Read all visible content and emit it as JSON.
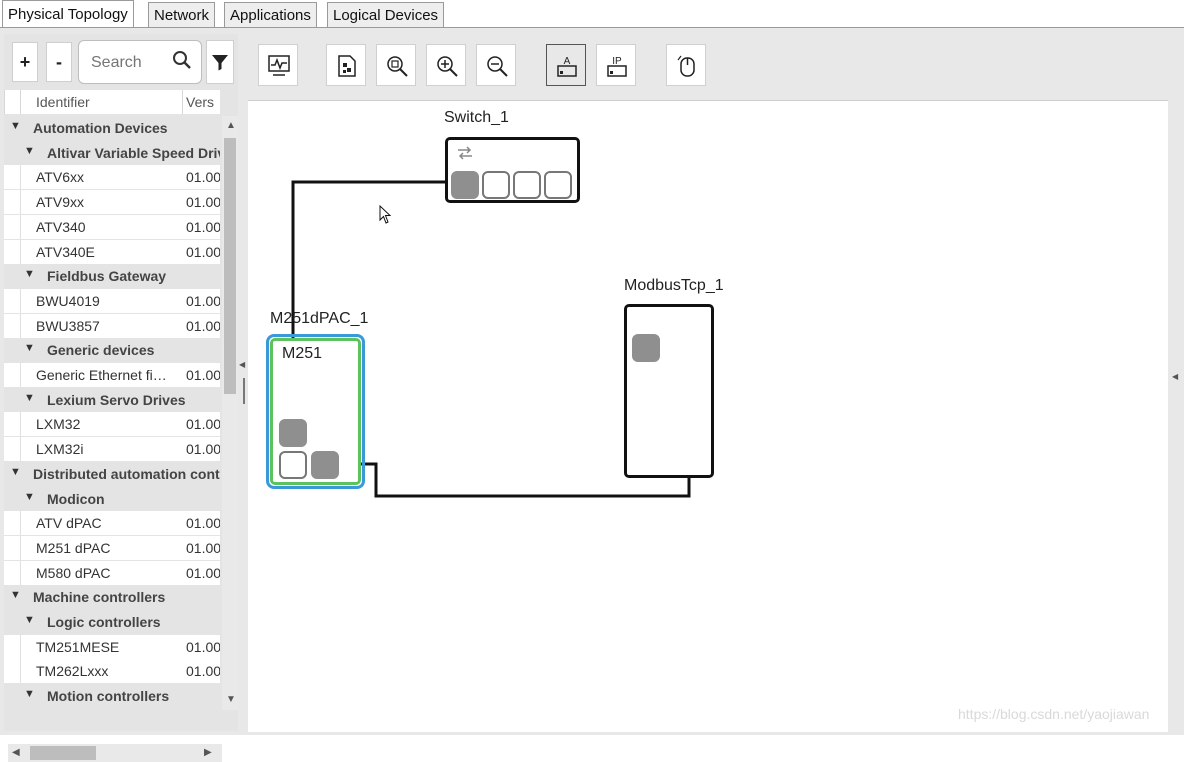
{
  "tabs": [
    {
      "label": "Physical Topology",
      "active": true
    },
    {
      "label": "Network",
      "active": false
    },
    {
      "label": "Applications",
      "active": false
    },
    {
      "label": "Logical Devices",
      "active": false
    }
  ],
  "left_panel": {
    "expand_label": "+",
    "collapse_label": "-",
    "search": {
      "placeholder": "Search",
      "value": ""
    },
    "columns": {
      "identifier": "Identifier",
      "version": "Vers"
    },
    "tree": [
      {
        "level": 1,
        "label": "Automation Devices"
      },
      {
        "level": 2,
        "label": "Altivar Variable Speed Drives"
      },
      {
        "level": 3,
        "label": "ATV6xx",
        "version": "01.00"
      },
      {
        "level": 3,
        "label": "ATV9xx",
        "version": "01.00"
      },
      {
        "level": 3,
        "label": "ATV340",
        "version": "01.00"
      },
      {
        "level": 3,
        "label": "ATV340E",
        "version": "01.00"
      },
      {
        "level": 2,
        "label": "Fieldbus Gateway"
      },
      {
        "level": 3,
        "label": "BWU4019",
        "version": "01.00"
      },
      {
        "level": 3,
        "label": "BWU3857",
        "version": "01.00"
      },
      {
        "level": 2,
        "label": "Generic devices"
      },
      {
        "level": 3,
        "label": "Generic Ethernet fi…",
        "version": "01.00"
      },
      {
        "level": 2,
        "label": "Lexium Servo Drives"
      },
      {
        "level": 3,
        "label": "LXM32",
        "version": "01.00"
      },
      {
        "level": 3,
        "label": "LXM32i",
        "version": "01.00"
      },
      {
        "level": 1,
        "label": "Distributed automation controllers"
      },
      {
        "level": 2,
        "label": "Modicon"
      },
      {
        "level": 3,
        "label": "ATV dPAC",
        "version": "01.00"
      },
      {
        "level": 3,
        "label": "M251 dPAC",
        "version": "01.00"
      },
      {
        "level": 3,
        "label": "M580 dPAC",
        "version": "01.00"
      },
      {
        "level": 1,
        "label": "Machine controllers"
      },
      {
        "level": 2,
        "label": "Logic controllers"
      },
      {
        "level": 3,
        "label": "TM251MESE",
        "version": "01.00"
      },
      {
        "level": 3,
        "label": "TM262Lxxx",
        "version": "01.00"
      },
      {
        "level": 2,
        "label": "Motion controllers"
      }
    ]
  },
  "toolbar": {
    "buttons": [
      {
        "icon": "monitor-icon",
        "active": false
      },
      {
        "icon": "device-properties-icon",
        "active": false
      },
      {
        "icon": "zoom-fit-icon",
        "active": false
      },
      {
        "icon": "zoom-in-icon",
        "active": false
      },
      {
        "icon": "zoom-out-icon",
        "active": false
      },
      {
        "icon": "show-address-icon",
        "label": "A",
        "active": true
      },
      {
        "icon": "show-ip-icon",
        "label": "IP",
        "active": false
      },
      {
        "icon": "mouse-mode-icon",
        "active": false
      }
    ]
  },
  "topology": {
    "switch": {
      "name": "Switch_1"
    },
    "controller": {
      "name": "M251dPAC_1",
      "model": "M251"
    },
    "modbus": {
      "name": "ModbusTcp_1"
    }
  },
  "watermark": "https://blog.csdn.net/yaojiawan",
  "colors": {
    "selection_outer": "#3a9ad9",
    "selection_inner": "#5cc35c",
    "port_filled": "#8f8f8f"
  }
}
